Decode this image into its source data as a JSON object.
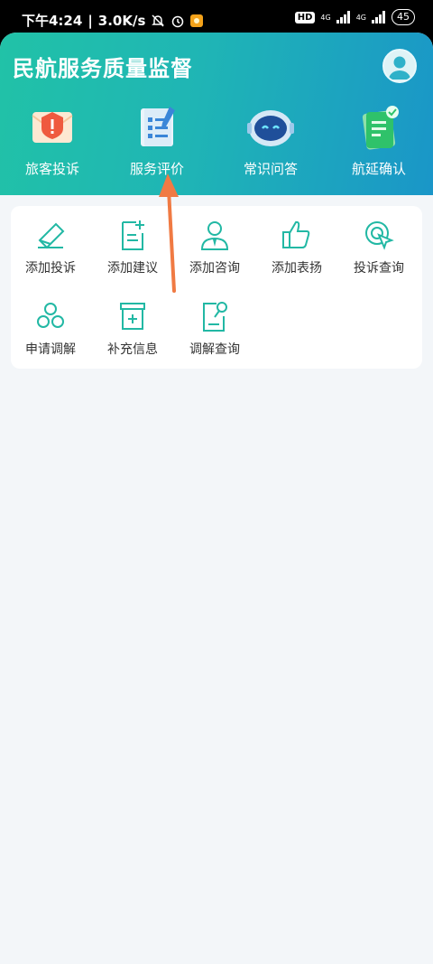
{
  "status_bar": {
    "time": "下午4:24",
    "speed": "3.0K/s",
    "net1": "4G",
    "net2": "4G",
    "hd": "HD",
    "battery": "45"
  },
  "header": {
    "title": "民航服务质量监督"
  },
  "top_nav": [
    {
      "label": "旅客投诉",
      "icon": "complaint-envelope-icon"
    },
    {
      "label": "服务评价",
      "icon": "service-rating-icon"
    },
    {
      "label": "常识问答",
      "icon": "robot-qa-icon"
    },
    {
      "label": "航延确认",
      "icon": "delay-confirm-icon"
    }
  ],
  "functions": [
    {
      "label": "添加投诉",
      "icon": "add-complaint-icon"
    },
    {
      "label": "添加建议",
      "icon": "add-suggestion-icon"
    },
    {
      "label": "添加咨询",
      "icon": "add-consult-icon"
    },
    {
      "label": "添加表扬",
      "icon": "thumbs-up-icon"
    },
    {
      "label": "投诉查询",
      "icon": "complaint-query-icon"
    },
    {
      "label": "申请调解",
      "icon": "mediation-icon"
    },
    {
      "label": "补充信息",
      "icon": "supplement-info-icon"
    },
    {
      "label": "调解查询",
      "icon": "mediation-query-icon"
    }
  ],
  "colors": {
    "accent": "#22b8a4",
    "header_start": "#21c2a7",
    "header_end": "#1a96c8",
    "arrow": "#f07a43",
    "background": "#f3f6f9"
  }
}
